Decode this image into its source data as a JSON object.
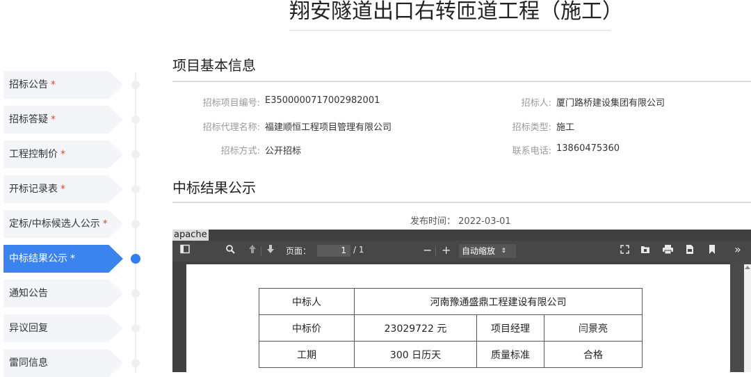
{
  "page_title": "翔安隧道出口右转匝道工程（施工）",
  "sidebar": {
    "items": [
      {
        "label": "招标公告",
        "required": "*"
      },
      {
        "label": "招标答疑",
        "required": "*"
      },
      {
        "label": "工程控制价",
        "required": "*"
      },
      {
        "label": "开标记录表",
        "required": "*"
      },
      {
        "label": "定标/中标候选人公示",
        "required": "*"
      },
      {
        "label": "中标结果公示",
        "required": "*",
        "active": true
      },
      {
        "label": "通知公告",
        "required": ""
      },
      {
        "label": "异议回复",
        "required": ""
      },
      {
        "label": "雷同信息",
        "required": ""
      }
    ]
  },
  "basic_info": {
    "heading": "项目基本信息",
    "fields": {
      "project_no": {
        "label": "招标项目编号:",
        "value": "E3500000717002982001"
      },
      "agent": {
        "label": "招标代理名称:",
        "value": "福建顺恒工程项目管理有限公司"
      },
      "method": {
        "label": "招标方式:",
        "value": "公开招标"
      },
      "tenderer": {
        "label": "招标人:",
        "value": "厦门路桥建设集团有限公司"
      },
      "type": {
        "label": "招标类型:",
        "value": "施工"
      },
      "phone": {
        "label": "联系电话:",
        "value": "13860475360"
      }
    }
  },
  "result": {
    "heading": "中标结果公示",
    "publish_label": "发布时间：",
    "publish_date": "2022-03-01"
  },
  "viewer": {
    "title": "apache",
    "page_label": "页面：",
    "page_current": "1",
    "page_total": "/ 1",
    "zoom": "自动缩放",
    "icons": [
      "sidebar-toggle-icon",
      "search-icon",
      "arrow-up-icon",
      "arrow-down-icon",
      "zoom-out-icon",
      "zoom-in-icon",
      "fullscreen-icon",
      "open-file-icon",
      "print-icon",
      "download-icon",
      "bookmark-icon",
      "more-tools-icon"
    ]
  },
  "award_table": {
    "winner_label": "中标人",
    "winner": "河南豫通盛鼎工程建设有限公司",
    "price_label": "中标价",
    "price": "23029722 元",
    "manager_label": "项目经理",
    "manager": "闫景亮",
    "period_label": "工期",
    "period": "300 日历天",
    "quality_label": "质量标准",
    "quality": "合格"
  },
  "colors": {
    "accent": "#3b84f0",
    "required": "#e0453a",
    "viewer_bg": "#404040"
  }
}
